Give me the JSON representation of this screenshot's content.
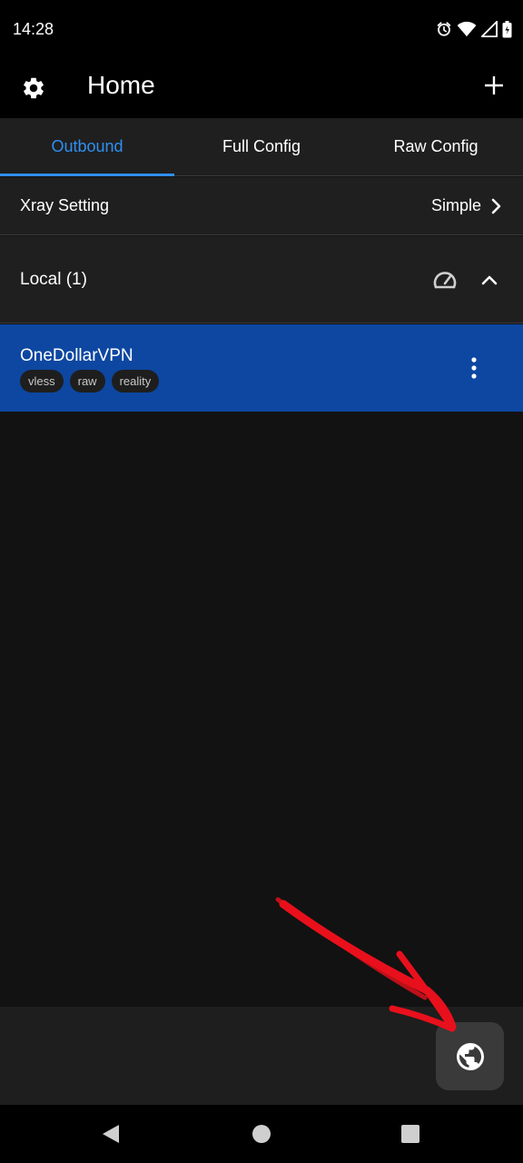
{
  "status_bar": {
    "time": "14:28",
    "icons": [
      "alarm-icon",
      "wifi-icon",
      "signal-icon",
      "battery-icon"
    ]
  },
  "app_bar": {
    "title": "Home",
    "left_icon": "gear-icon",
    "right_icon": "plus-icon"
  },
  "tabs": [
    {
      "label": "Outbound",
      "active": true
    },
    {
      "label": "Full Config",
      "active": false
    },
    {
      "label": "Raw Config",
      "active": false
    }
  ],
  "xray_setting": {
    "label": "Xray Setting",
    "value": "Simple"
  },
  "group": {
    "label": "Local (1)",
    "icons": [
      "speedometer-icon",
      "chevron-up-icon"
    ]
  },
  "servers": [
    {
      "name": "OneDollarVPN",
      "tags": [
        "vless",
        "raw",
        "reality"
      ]
    }
  ],
  "fab": {
    "icon": "globe-icon"
  },
  "nav_bar": {
    "icons": [
      "back-icon",
      "home-icon",
      "recents-icon"
    ]
  },
  "colors": {
    "accent": "#2f8ff0",
    "selected_row": "#0d47a1",
    "annotation": "#e8101c"
  }
}
